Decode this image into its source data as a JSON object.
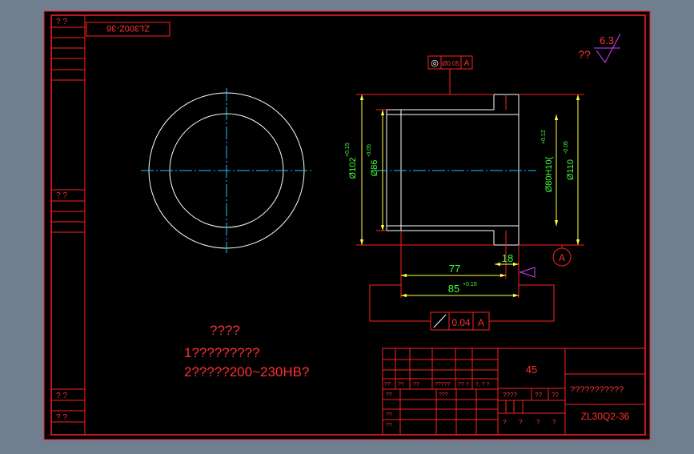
{
  "app": {
    "viewport_bg": "#6f7f8f",
    "sheet_bg": "#000000"
  },
  "colors": {
    "frame": "#ff2020",
    "part": "#ffffff",
    "center": "#20c0ff",
    "dim": "#ffff40",
    "dim_text": "#40ff40",
    "note": "#ff3030",
    "symbol": "#d040ff"
  },
  "drawing_no_rotated": "ZL300Z-36",
  "left_strip": {
    "top": "?   ?",
    "mid": "?   ?",
    "b1": "?   ?",
    "b2": "?   ?"
  },
  "tolerance_top": {
    "symbol": "◎",
    "value": "Ø0.05",
    "datum": "A"
  },
  "tolerance_bottom": {
    "value": "0.04",
    "datum": "A"
  },
  "roughness": {
    "label": "??",
    "value": "6.3"
  },
  "dims": {
    "d102": "Ø102",
    "d102_tol": "+0.15",
    "d86": "Ø86",
    "d86_tol": "-0.05",
    "d80": "Ø80H10(",
    "d80_tol": "+0.12",
    "d110": "Ø110",
    "d110_tol": "-0.05",
    "len77": "77",
    "len18": "18",
    "len85": "85",
    "len85_tol": "+0.15",
    "datum_a": "A"
  },
  "notes": {
    "title": "????",
    "line1": "1?????????",
    "line2": "2?????200~230HB?"
  },
  "title_block": {
    "material": "45",
    "name": "???????????",
    "drawing_no": "ZL30Q2-36",
    "r1": [
      "??",
      "??",
      "??",
      "?????",
      "?? ?",
      "?, ? ?"
    ],
    "r2": [
      "??",
      "",
      "???",
      ""
    ],
    "r3": [
      "??",
      "",
      "",
      ""
    ],
    "r4": [
      "??",
      "",
      "",
      ""
    ],
    "stage": [
      "????",
      "??",
      "??"
    ],
    "bottom": [
      "?",
      "?",
      "?",
      "?"
    ]
  }
}
